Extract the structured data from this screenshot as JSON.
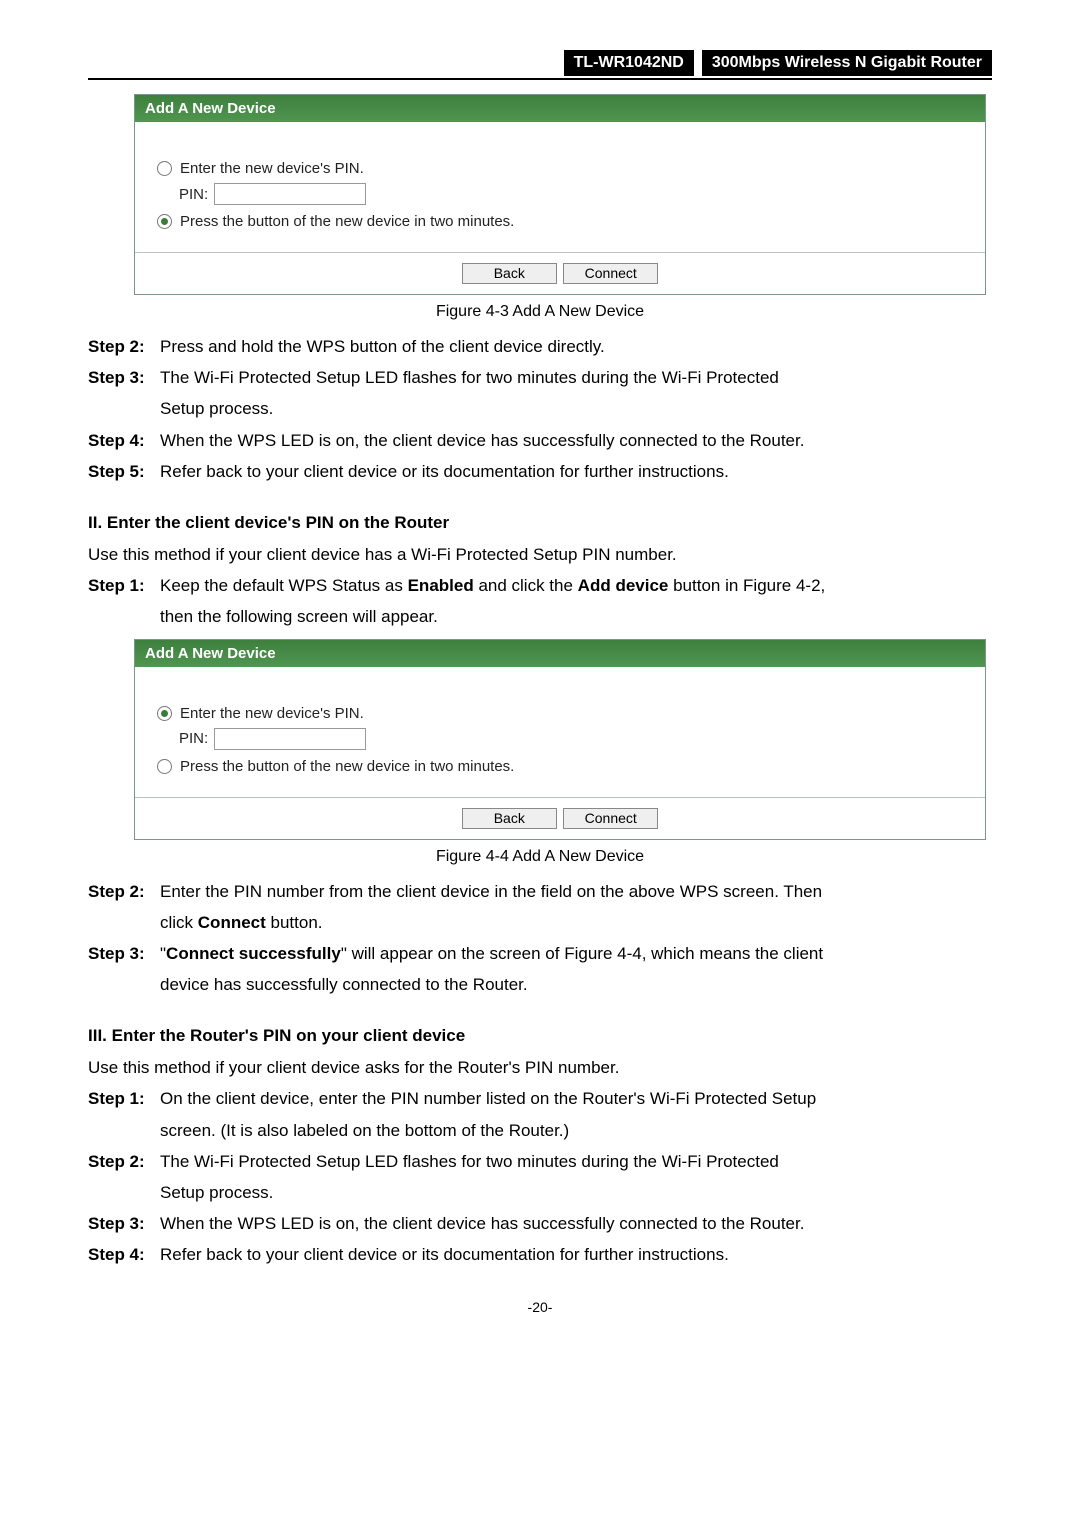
{
  "header": {
    "model": "TL-WR1042ND",
    "product": "300Mbps Wireless N Gigabit Router"
  },
  "fig1": {
    "title": "Add A New Device",
    "opt_pin": "Enter the new device's PIN.",
    "pin_label": "PIN:",
    "opt_press": "Press the button of the new device in two minutes.",
    "back": "Back",
    "connect": "Connect",
    "caption": "Figure 4-3 Add A New Device"
  },
  "steps_a": {
    "s2_lbl": "Step 2:",
    "s2_txt": "Press and hold the WPS button of the client device directly.",
    "s3_lbl": "Step 3:",
    "s3_txt": "The Wi-Fi Protected Setup LED flashes for two minutes during the Wi-Fi Protected",
    "s3_cont": "Setup process.",
    "s4_lbl": "Step 4:",
    "s4_txt": "When the WPS LED is on, the client device has successfully connected to the Router.",
    "s5_lbl": "Step 5:",
    "s5_txt": "Refer back to your client device or its documentation for further instructions."
  },
  "sec2": {
    "head": "II.   Enter the client device's PIN on the Router",
    "intro": "Use this method if your client device has a Wi-Fi Protected Setup PIN number.",
    "s1_lbl": "Step 1:",
    "s1_pre": "Keep the default WPS Status as ",
    "s1_b1": "Enabled",
    "s1_mid": " and click the ",
    "s1_b2": "Add device",
    "s1_post": " button in Figure 4-2,",
    "s1_cont": "then the following screen will appear."
  },
  "fig2": {
    "title": "Add A New Device",
    "opt_pin": "Enter the new device's PIN.",
    "pin_label": "PIN:",
    "opt_press": "Press the button of the new device in two minutes.",
    "back": "Back",
    "connect": "Connect",
    "caption": "Figure 4-4   Add A New Device"
  },
  "steps_b": {
    "s2_lbl": "Step 2:",
    "s2_txt": "Enter the PIN number from the client device in the field on the above WPS screen. Then",
    "s2_cont_pre": "click ",
    "s2_cont_b": "Connect",
    "s2_cont_post": " button.",
    "s3_lbl": "Step 3:",
    "s3_pre": "\"",
    "s3_b": "Connect successfully",
    "s3_post": "\" will appear on the screen of Figure 4-4, which means the client",
    "s3_cont": "device has successfully connected to the Router."
  },
  "sec3": {
    "head": "III.  Enter the Router's PIN on your client device",
    "intro": "Use this method if your client device asks for the Router's PIN number.",
    "s1_lbl": "Step 1:",
    "s1_txt": "On the client device, enter the PIN number listed on the Router's Wi-Fi Protected Setup",
    "s1_cont": "screen. (It is also labeled on the bottom of the Router.)",
    "s2_lbl": "Step 2:",
    "s2_txt": "The Wi-Fi Protected Setup LED flashes for two minutes during the Wi-Fi Protected",
    "s2_cont": "Setup process.",
    "s3_lbl": "Step 3:",
    "s3_txt": "When the WPS LED is on, the client device has successfully connected to the Router.",
    "s4_lbl": "Step 4:",
    "s4_txt": "Refer back to your client device or its documentation for further instructions."
  },
  "page_num": "-20-"
}
